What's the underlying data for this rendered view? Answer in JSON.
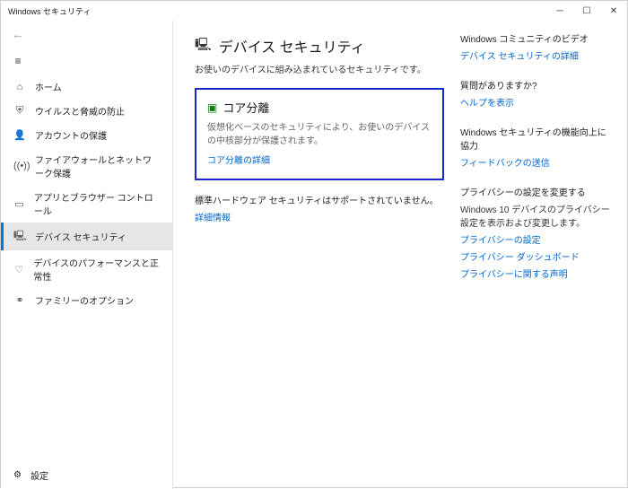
{
  "window": {
    "title": "Windows セキュリティ"
  },
  "sidebar": {
    "items": [
      {
        "label": "ホーム"
      },
      {
        "label": "ウイルスと脅威の防止"
      },
      {
        "label": "アカウントの保護"
      },
      {
        "label": "ファイアウォールとネットワーク保護"
      },
      {
        "label": "アプリとブラウザー コントロール"
      },
      {
        "label": "デバイス セキュリティ"
      },
      {
        "label": "デバイスのパフォーマンスと正常性"
      },
      {
        "label": "ファミリーのオプション"
      }
    ],
    "settings": "設定"
  },
  "page": {
    "title": "デバイス セキュリティ",
    "subtitle": "お使いのデバイスに組み込まれているセキュリティです。"
  },
  "core_isolation": {
    "heading": "コア分離",
    "desc": "仮想化ベースのセキュリティにより、お使いのデバイスの中核部分が保護されます。",
    "link": "コア分離の詳細"
  },
  "hwsec": {
    "text": "標準ハードウェア セキュリティはサポートされていません。",
    "link": "詳細情報"
  },
  "right": {
    "community": {
      "heading": "Windows コミュニティのビデオ",
      "link": "デバイス セキュリティの詳細"
    },
    "help": {
      "heading": "質問がありますか?",
      "link": "ヘルプを表示"
    },
    "feedback": {
      "heading": "Windows セキュリティの機能向上に協力",
      "link": "フィードバックの送信"
    },
    "privacy": {
      "heading": "プライバシーの設定を変更する",
      "text": "Windows 10 デバイスのプライバシー設定を表示および変更します。",
      "link1": "プライバシーの設定",
      "link2": "プライバシー ダッシュボード",
      "link3": "プライバシーに関する声明"
    }
  }
}
